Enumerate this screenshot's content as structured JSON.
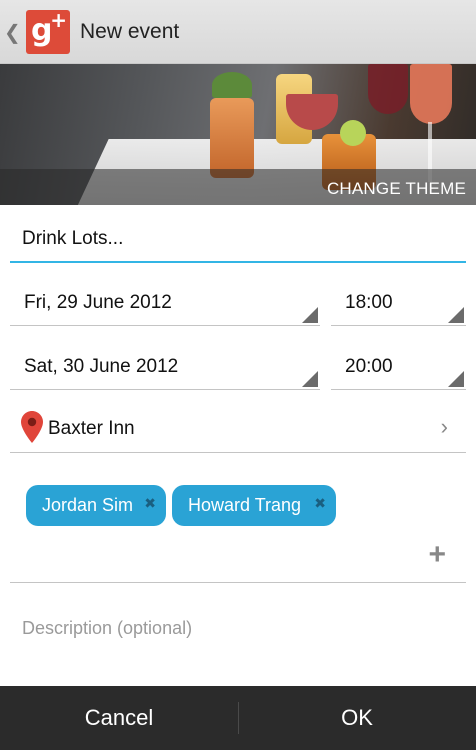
{
  "actionbar": {
    "back_icon": "chevron-left-icon",
    "logo_icon": "google-plus-logo",
    "logo_glyph": "g",
    "logo_plus": "+",
    "title": "New event"
  },
  "banner": {
    "change_theme_label": "CHANGE THEME"
  },
  "form": {
    "title_value": "Drink Lots...",
    "start_date": "Fri, 29 June 2012",
    "start_time": "18:00",
    "end_date": "Sat, 30 June 2012",
    "end_time": "20:00",
    "location_icon": "map-pin-icon",
    "location": "Baxter Inn",
    "guests": [
      {
        "name": "Jordan Sim",
        "remove_glyph": "✖"
      },
      {
        "name": "Howard Trang",
        "remove_glyph": "✖"
      }
    ],
    "add_guest_glyph": "+",
    "description_placeholder": "Description (optional)"
  },
  "bottombar": {
    "cancel_label": "Cancel",
    "ok_label": "OK"
  },
  "colors": {
    "accent": "#33b5e5",
    "chip": "#2aa3d5",
    "gplus_red": "#dd4b39",
    "pin_red": "#e0453a",
    "bottom_bar": "#2b2b2b"
  }
}
